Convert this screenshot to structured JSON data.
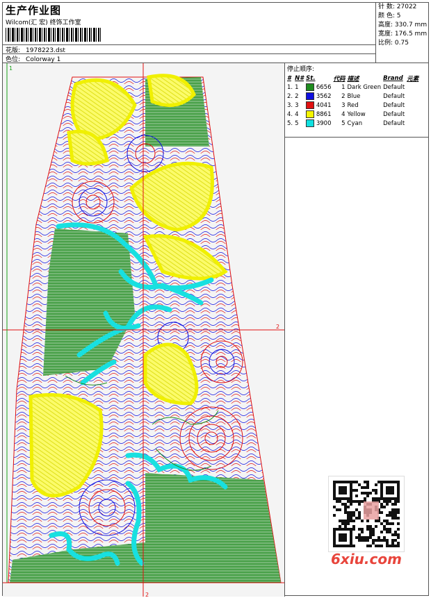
{
  "header": {
    "title": "生产作业图",
    "subtitle": "Wilcom(汇 宏) 终饰工作室",
    "design_label": "花版:",
    "design_value": "1978223.dst",
    "colorway_label": "色位:",
    "colorway_value": "Colorway 1"
  },
  "stats": [
    {
      "label": "针 数:",
      "value": "27022"
    },
    {
      "label": "颜 色:",
      "value": "5"
    },
    {
      "label": "高度:",
      "value": "330.7 mm"
    },
    {
      "label": "宽度:",
      "value": "176.5 mm"
    },
    {
      "label": "比例:",
      "value": "0.75"
    }
  ],
  "canvas": {
    "marker_top": "1",
    "marker_right": "2",
    "marker_bottom": "2"
  },
  "thread_panel": {
    "title": "停止顺序:",
    "columns": [
      "#",
      "N#",
      "St.",
      "代码",
      "描述",
      "Brand",
      "元素"
    ],
    "rows": [
      {
        "num": "1.",
        "n": "1",
        "color": "#1e8c1e",
        "stitches": "6656",
        "code": "1",
        "desc": "Dark Green",
        "brand": "Default"
      },
      {
        "num": "2.",
        "n": "2",
        "color": "#1010e0",
        "stitches": "3562",
        "code": "2",
        "desc": "Blue",
        "brand": "Default"
      },
      {
        "num": "3.",
        "n": "3",
        "color": "#e01010",
        "stitches": "4041",
        "code": "3",
        "desc": "Red",
        "brand": "Default"
      },
      {
        "num": "4.",
        "n": "4",
        "color": "#f5f500",
        "stitches": "8861",
        "code": "4",
        "desc": "Yellow",
        "brand": "Default"
      },
      {
        "num": "5.",
        "n": "5",
        "color": "#10e0e0",
        "stitches": "3900",
        "code": "5",
        "desc": "Cyan",
        "brand": "Default"
      }
    ]
  },
  "watermark": "6xiu.com",
  "qr_icon": "qr-code-icon"
}
